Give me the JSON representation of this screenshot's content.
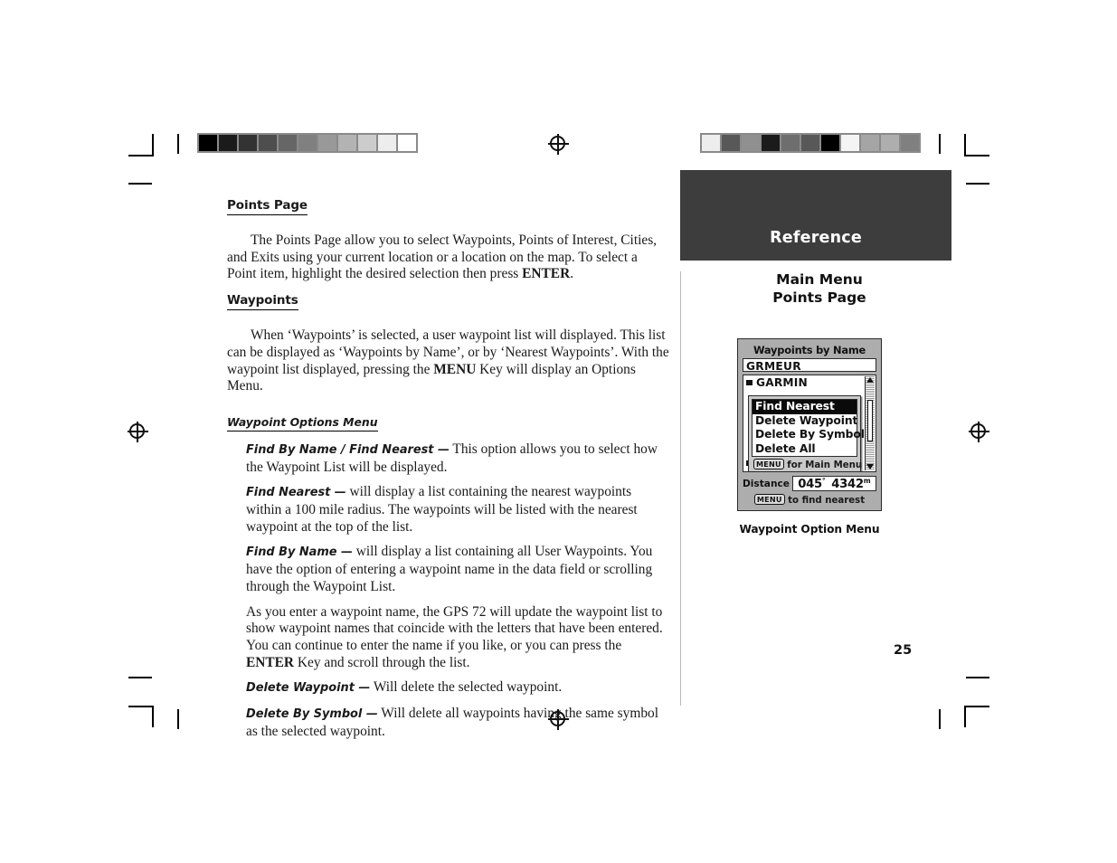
{
  "page": {
    "number": "25",
    "side_banner": "Reference",
    "side_title_line1": "Main Menu",
    "side_title_line2": "Points Page",
    "banner_color": "#3d3d3d"
  },
  "content": {
    "heading_points_page": "Points Page",
    "para_points_page_pre": "The Points Page allow you to select Waypoints, Points of Interest, Cities, and Exits using your current location or a location on the map.  To select a Point item, highlight the desired selection then press ",
    "para_points_page_bold": "ENTER",
    "para_points_page_post": ".",
    "heading_waypoints": "Waypoints",
    "para_waypoints_pre": "When ‘Waypoints’ is selected, a user waypoint list will displayed.  This list can be displayed as ‘Waypoints by Name’, or by ‘Nearest Waypoints’.  With the waypoint list displayed, pressing the ",
    "para_waypoints_bold": "MENU",
    "para_waypoints_post": " Key will display an Options Menu.",
    "heading_options_menu": "Waypoint Options Menu",
    "definitions": [
      {
        "term": "Find By Name / Find Nearest —",
        "text": " This option allows you to select how the Waypoint List will be displayed."
      },
      {
        "term": "Find Nearest —",
        "text": " will display a list containing the nearest waypoints within a 100 mile radius.  The waypoints will be listed with the nearest waypoint at the top of the list."
      },
      {
        "term": "Find By Name —",
        "text": " will display a list containing all User Waypoints.  You have the option of entering a waypoint name in the data field or scrolling through the Waypoint List."
      }
    ],
    "para_enter_name_pre": "As you enter a waypoint name, the GPS 72 will update the waypoint list to show waypoint names that coincide with the letters that have been entered.  You can continue to enter the name if you like, or you can press the ",
    "para_enter_name_bold": "ENTER",
    "para_enter_name_post": " Key and scroll through the list.",
    "definitions_tail": [
      {
        "term": "Delete Waypoint —",
        "text": " Will delete the selected waypoint."
      },
      {
        "term": "Delete By Symbol —",
        "text": " Will delete all waypoints having the same symbol as the selected waypoint."
      }
    ]
  },
  "gps_screen": {
    "title": "Waypoints by Name",
    "name_field_value": "GRMEUR",
    "list_item_behind_top": "GARMIN",
    "list_item_behind_bottom": "HAF",
    "menu_items": [
      {
        "label": "Find Nearest",
        "selected": true
      },
      {
        "label": "Delete Waypoint",
        "selected": false
      },
      {
        "label": "Delete By Symbol",
        "selected": false
      },
      {
        "label": "Delete All",
        "selected": false
      }
    ],
    "popup_hint_key": "MENU",
    "popup_hint_text": "for Main Menu",
    "distance_label": "Distance",
    "distance_bearing": "045",
    "distance_bearing_unit": "°",
    "distance_value": "4342",
    "distance_unit": "m",
    "footer_key": "MENU",
    "footer_text": "to find nearest",
    "caption": "Waypoint Option Menu"
  },
  "colorbars": {
    "left": [
      "#000000",
      "#1b1b1b",
      "#333333",
      "#4e4e4e",
      "#666666",
      "#808080",
      "#999999",
      "#b3b3b3",
      "#cccccc",
      "#ededed",
      "#ffffff"
    ],
    "right": [
      "#ededed",
      "#585858",
      "#909090",
      "#1b1b1b",
      "#6e6e6e",
      "#585858",
      "#000000",
      "#f4f4f4",
      "#a5a5a5",
      "#aeaeae",
      "#808080"
    ]
  }
}
